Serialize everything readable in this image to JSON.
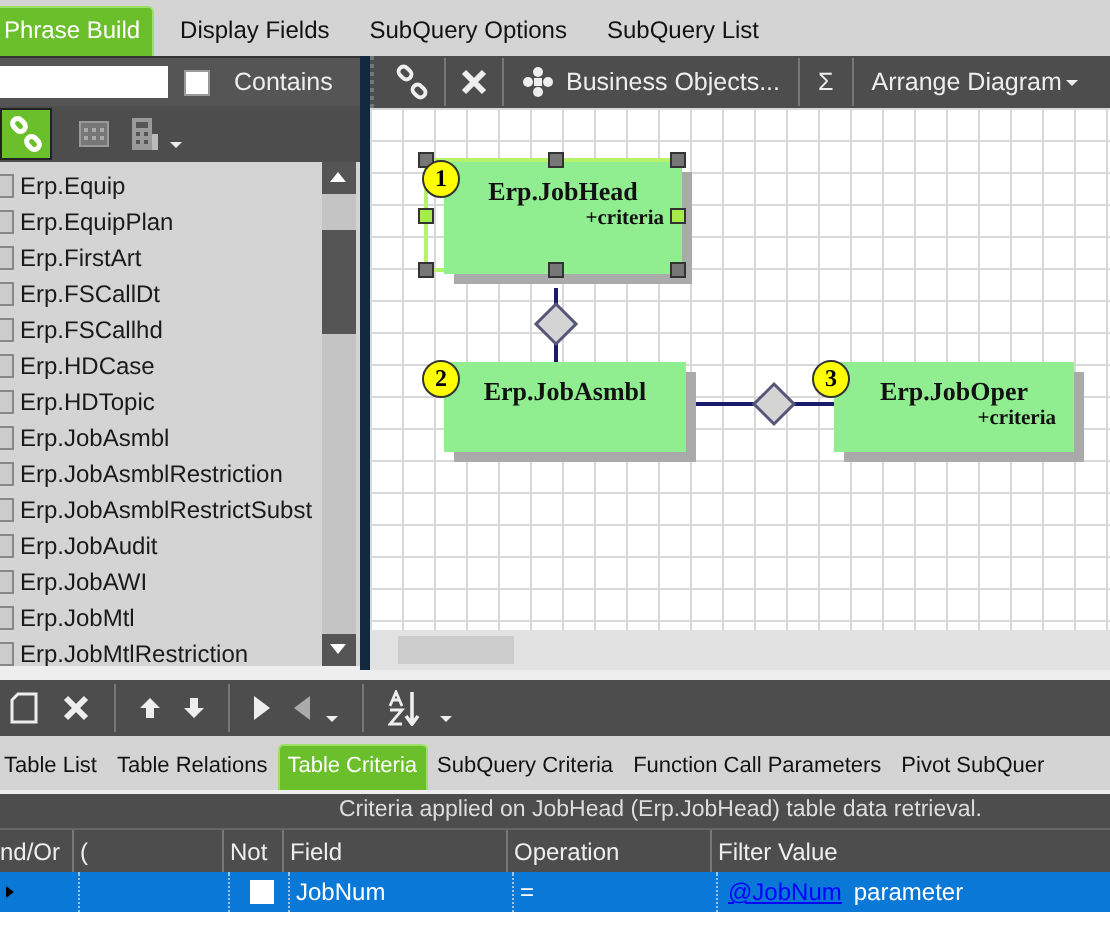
{
  "top_tabs": [
    {
      "label": "Phrase Build",
      "selected": true
    },
    {
      "label": "Display Fields",
      "selected": false
    },
    {
      "label": "SubQuery Options",
      "selected": false
    },
    {
      "label": "SubQuery List",
      "selected": false
    }
  ],
  "contains": {
    "label": "Contains",
    "checked": false
  },
  "table_list": [
    "Erp.Equip",
    "Erp.EquipPlan",
    "Erp.FirstArt",
    "Erp.FSCallDt",
    "Erp.FSCallhd",
    "Erp.HDCase",
    "Erp.HDTopic",
    "Erp.JobAsmbl",
    "Erp.JobAsmblRestriction",
    "Erp.JobAsmblRestrictSubst",
    "Erp.JobAudit",
    "Erp.JobAWI",
    "Erp.JobMtl",
    "Erp.JobMtlRestriction"
  ],
  "diagram_toolbar": {
    "business_objects": "Business Objects...",
    "sum": "Σ",
    "arrange": "Arrange Diagram"
  },
  "diagram": {
    "nodes": [
      {
        "number": "1",
        "name": "Erp.JobHead",
        "criteria": "+criteria",
        "selected": true
      },
      {
        "number": "2",
        "name": "Erp.JobAsmbl",
        "selected": false
      },
      {
        "number": "3",
        "name": "Erp.JobOper",
        "criteria": "+criteria",
        "selected": false
      }
    ]
  },
  "bottom_tabs": [
    {
      "label": "Table List",
      "selected": false
    },
    {
      "label": "Table Relations",
      "selected": false
    },
    {
      "label": "Table Criteria",
      "selected": true
    },
    {
      "label": "SubQuery Criteria",
      "selected": false
    },
    {
      "label": "Function Call Parameters",
      "selected": false
    },
    {
      "label": "Pivot SubQuer",
      "selected": false
    }
  ],
  "criteria_caption": "Criteria applied on JobHead (Erp.JobHead)  table data retrieval.",
  "table": {
    "columns": [
      "nd/Or",
      "(",
      "Not",
      "Field",
      "Operation",
      "Filter Value"
    ],
    "rows": [
      {
        "selected": true,
        "not": false,
        "field": "JobNum",
        "operation": "=",
        "filter_link": "@JobNum",
        "filter_text": "parameter"
      }
    ]
  }
}
